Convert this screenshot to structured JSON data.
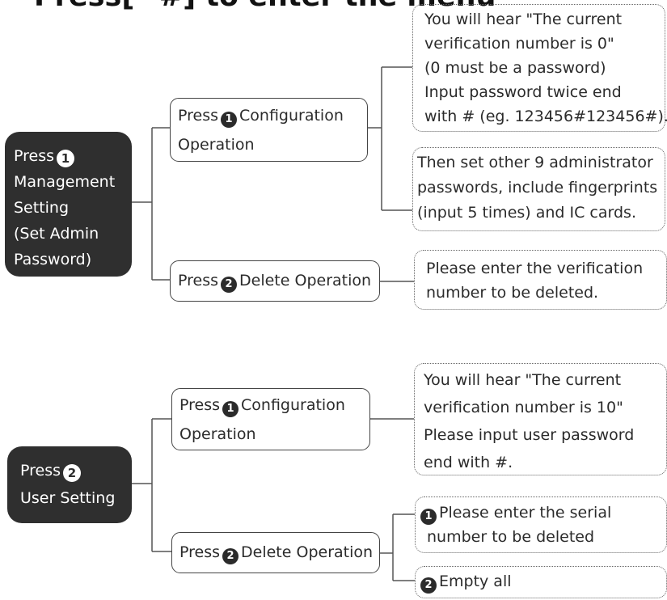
{
  "title": "Press[ *#] to enter the menu",
  "sections": [
    {
      "root": {
        "press": "Press",
        "num": "1",
        "lines": [
          "Management",
          "Setting",
          "(Set Admin",
          "Password)"
        ]
      },
      "branches": [
        {
          "press": "Press",
          "num": "1",
          "label_a": "Configuration",
          "label_b": "Operation",
          "notes": [
            {
              "lines": [
                "You will hear \"The current",
                "verification number is 0\"",
                "(0 must be a password)",
                "Input password twice end",
                "with # (eg. 123456#123456#)."
              ]
            },
            {
              "lines": [
                "Then set other 9 administrator",
                "passwords, include fingerprints",
                "(input 5 times) and IC cards."
              ]
            }
          ]
        },
        {
          "press": "Press",
          "num": "2",
          "label_a": "Delete Operation",
          "notes": [
            {
              "lines": [
                "Please enter the verification",
                "number to be deleted."
              ]
            }
          ]
        }
      ]
    },
    {
      "root": {
        "press": "Press",
        "num": "2",
        "lines": [
          "User Setting"
        ]
      },
      "branches": [
        {
          "press": "Press",
          "num": "1",
          "label_a": "Configuration",
          "label_b": "Operation",
          "notes": [
            {
              "lines": [
                "You will hear \"The current",
                "verification number is 10\"",
                "Please input user password",
                "end with #."
              ]
            }
          ]
        },
        {
          "press": "Press",
          "num": "2",
          "label_a": "Delete Operation",
          "notes": [
            {
              "num": "1",
              "lines": [
                "Please enter the serial",
                "number to be deleted"
              ]
            },
            {
              "num": "2",
              "lines": [
                "Empty all"
              ]
            }
          ]
        }
      ]
    }
  ]
}
